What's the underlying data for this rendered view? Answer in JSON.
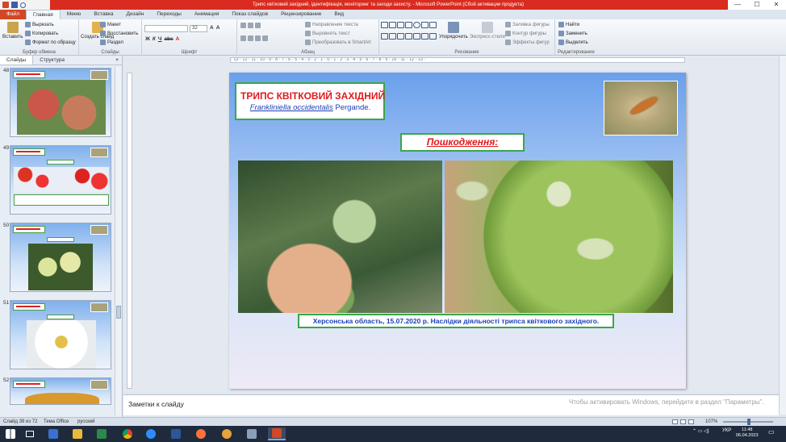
{
  "window": {
    "title": "Трипс квітковий західний, ідентифікація, моніторинг та заходи захисту.  -  Microsoft PowerPoint (Сбой активации продукта)",
    "minimize": "—",
    "maximize": "☐",
    "close": "✕"
  },
  "ribbon_tabs": [
    "Файл",
    "Главная",
    "Меню",
    "Вставка",
    "Дизайн",
    "Переходы",
    "Анимация",
    "Показ слайдов",
    "Рецензирование",
    "Вид"
  ],
  "clipboard": {
    "paste": "Вставить",
    "cut": "Вырезать",
    "copy": "Копировать",
    "format_painter": "Формат по образцу",
    "label": "Буфер обмена"
  },
  "slides_group": {
    "create": "Создать слайд",
    "layout": "Макет",
    "reset": "Восстановить",
    "section": "Раздел",
    "label": "Слайды"
  },
  "font_group": {
    "font_size": "32",
    "label": "Шрифт"
  },
  "paragraph_group": {
    "text_direction": "Направление текста",
    "align_text": "Выровнять текст",
    "smartart": "Преобразовать в SmartArt",
    "label": "Абзац"
  },
  "drawing_group": {
    "arrange": "Упорядочить",
    "quick_styles": "Экспресс-стили",
    "shape_fill": "Заливка фигуры",
    "shape_outline": "Контур фигуры",
    "shape_effects": "Эффекты фигур",
    "label": "Рисование"
  },
  "editing_group": {
    "find": "Найти",
    "replace": "Заменить",
    "select": "Выделить",
    "label": "Редактирование"
  },
  "left_panel": {
    "tab_slides": "Слайды",
    "tab_outline": "Структура",
    "close": "×",
    "slide_numbers": [
      "48",
      "49",
      "50",
      "51",
      "52"
    ]
  },
  "ruler_text": "· 13 · 12 · 11 · 10 · 9 · 8 · 7 · 6 · 5 · 4 · 3 · 2 · 1 · 0 · 1 · 2 · 3 · 4 · 5 · 6 · 7 · 8 · 9 · 10 · 11 · 12 · 13 ·",
  "slide": {
    "title": "ТРИПС КВІТКОВИЙ ЗАХІДНИЙ",
    "species_latin": "Frankliniella occidentalis",
    "species_author": " Pergande.",
    "damage_heading": "Пошкодження:",
    "caption": "Херсонська  область,  15.07.2020  р.  Наслідки  діяльності  трипса  квіткового  західного."
  },
  "notes": {
    "placeholder": "Заметки к слайду",
    "activation_watermark": "Чтобы активировать Windows, перейдите в раздел \"Параметры\"."
  },
  "statusbar": {
    "slide_counter": "Слайд 39 из 72",
    "theme": "Тема Office",
    "language": "русский",
    "zoom": "107%"
  },
  "taskbar": {
    "language": "УКР",
    "time": "11:48",
    "date": "06.04.2023"
  },
  "colors": {
    "title_red": "#e0191d",
    "caption_blue": "#1c3fb4",
    "frame_green": "#3aa64a",
    "file_tab": "#d24726"
  }
}
